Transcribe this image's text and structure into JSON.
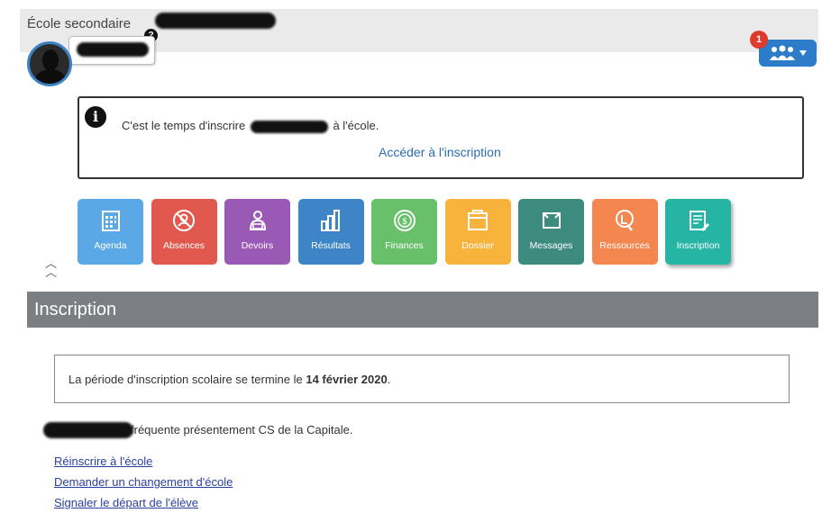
{
  "header": {
    "school_label": "École secondaire",
    "help_badge": "?",
    "notification_count": "1"
  },
  "alert": {
    "icon_glyph": "i",
    "text_before": "C'est le temps d'inscrire",
    "text_after": "à l'école.",
    "link_label": "Accéder à l'inscription"
  },
  "tiles": [
    {
      "label": "Agenda",
      "color": "#5aa9e6",
      "icon": "calendar-icon"
    },
    {
      "label": "Absences",
      "color": "#e0584e",
      "icon": "absence-icon"
    },
    {
      "label": "Devoirs",
      "color": "#9b59b6",
      "icon": "homework-icon"
    },
    {
      "label": "Résultats",
      "color": "#3d85c6",
      "icon": "chart-icon"
    },
    {
      "label": "Finances",
      "color": "#68c16a",
      "icon": "money-icon"
    },
    {
      "label": "Dossier",
      "color": "#f7b33b",
      "icon": "folder-icon"
    },
    {
      "label": "Messages",
      "color": "#3d8a7f",
      "icon": "message-icon"
    },
    {
      "label": "Ressources",
      "color": "#f4864f",
      "icon": "resources-icon"
    },
    {
      "label": "Inscription",
      "color": "#26b5a4",
      "icon": "registration-icon"
    }
  ],
  "section": {
    "title": "Inscription"
  },
  "info": {
    "text": "La période d'inscription scolaire se termine le ",
    "date": "14 février 2020",
    "suffix": "."
  },
  "status": {
    "text": "fréquente présentement CS de la Capitale."
  },
  "links": [
    "Réinscrire à l'école",
    "Demander un changement d'école",
    "Signaler le départ de l'élève"
  ],
  "colors": {
    "accent_blue": "#2d7cc9",
    "header_gray": "#7b7f83",
    "badge_red": "#e03a2e"
  }
}
